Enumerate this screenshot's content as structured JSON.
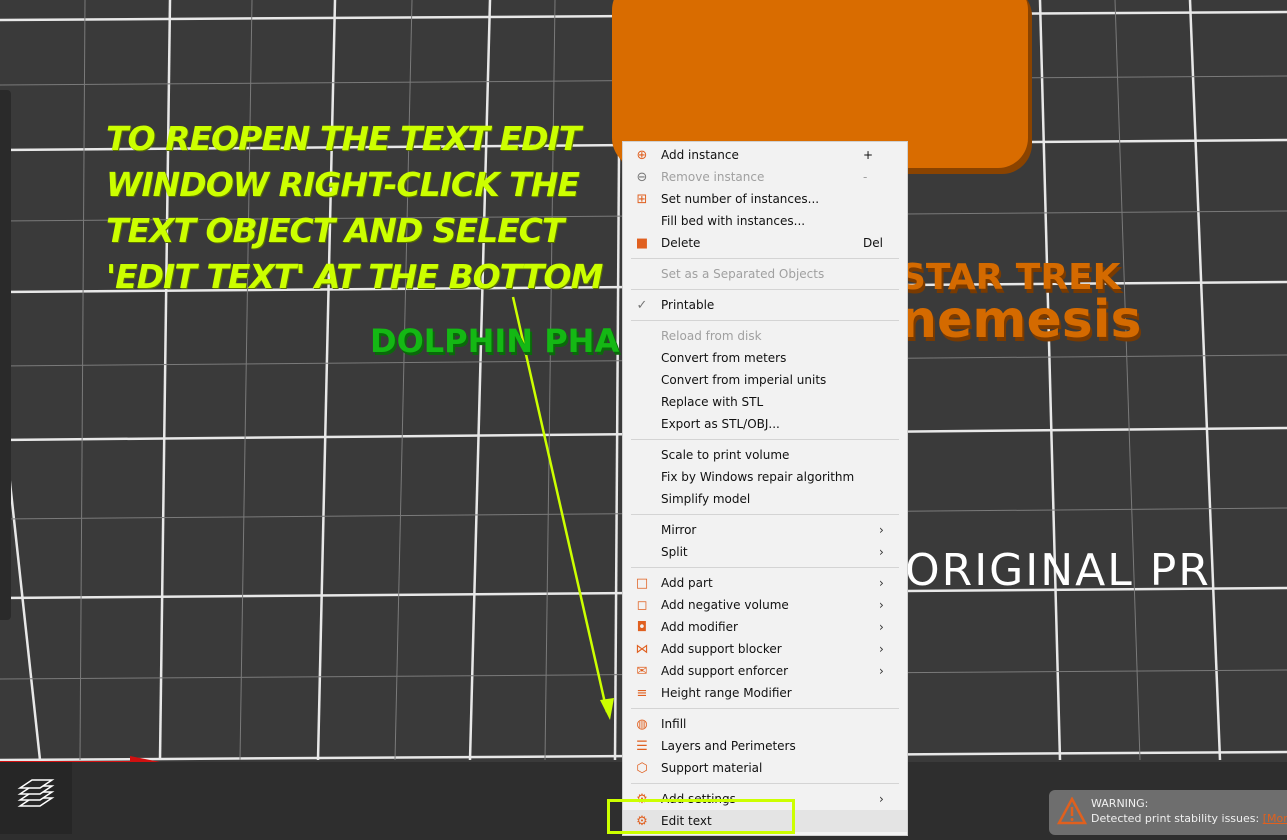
{
  "annotation": {
    "text": "TO REOPEN THE TEXT EDIT\nWINDOW RIGHT-CLICK THE\nTEXT OBJECT AND SELECT\n'EDIT TEXT' AT THE BOTTOM",
    "color": "#ccff00"
  },
  "scene": {
    "dolphin_text": "DOLPHIN PHA",
    "startrek_line1": "STAR TREK",
    "startrek_line2": "nemesis",
    "original_text": "ORIGINAL PR"
  },
  "menu": {
    "groups": [
      [
        {
          "icon": "plus-circle-icon",
          "label": "Add instance",
          "shortcut": "+"
        },
        {
          "icon": "minus-circle-icon",
          "label": "Remove instance",
          "shortcut": "-",
          "disabled": true
        },
        {
          "icon": "instances-icon",
          "label": "Set number of instances..."
        },
        {
          "icon": "",
          "label": "Fill bed with instances..."
        },
        {
          "icon": "trash-icon",
          "label": "Delete",
          "shortcut": "Del"
        }
      ],
      [
        {
          "icon": "",
          "label": "Set as a Separated Objects",
          "disabled": true
        }
      ],
      [
        {
          "icon": "check-icon",
          "label": "Printable"
        }
      ],
      [
        {
          "icon": "",
          "label": "Reload from disk",
          "disabled": true
        },
        {
          "icon": "",
          "label": "Convert from meters"
        },
        {
          "icon": "",
          "label": "Convert from imperial units"
        },
        {
          "icon": "",
          "label": "Replace with STL"
        },
        {
          "icon": "",
          "label": "Export as STL/OBJ..."
        }
      ],
      [
        {
          "icon": "",
          "label": "Scale to print volume"
        },
        {
          "icon": "",
          "label": "Fix by Windows repair algorithm"
        },
        {
          "icon": "",
          "label": "Simplify model"
        }
      ],
      [
        {
          "icon": "",
          "label": "Mirror",
          "submenu": true
        },
        {
          "icon": "",
          "label": "Split",
          "submenu": true
        }
      ],
      [
        {
          "icon": "add-part-icon",
          "label": "Add part",
          "submenu": true
        },
        {
          "icon": "negative-volume-icon",
          "label": "Add negative volume",
          "submenu": true
        },
        {
          "icon": "modifier-icon",
          "label": "Add modifier",
          "submenu": true
        },
        {
          "icon": "support-blocker-icon",
          "label": "Add support blocker",
          "submenu": true
        },
        {
          "icon": "support-enforcer-icon",
          "label": "Add support enforcer",
          "submenu": true
        },
        {
          "icon": "height-range-icon",
          "label": "Height range Modifier"
        }
      ],
      [
        {
          "icon": "infill-icon",
          "label": "Infill"
        },
        {
          "icon": "layers-icon",
          "label": "Layers and Perimeters"
        },
        {
          "icon": "support-material-icon",
          "label": "Support material"
        }
      ],
      [
        {
          "icon": "settings-icon",
          "label": "Add settings",
          "submenu": true
        },
        {
          "icon": "edit-text-icon",
          "label": "Edit text",
          "highlighted": true
        }
      ]
    ]
  },
  "warning": {
    "title": "WARNING:",
    "message": "Detected print stability issues:",
    "link": "[More]",
    "accent": "#e0601e"
  }
}
